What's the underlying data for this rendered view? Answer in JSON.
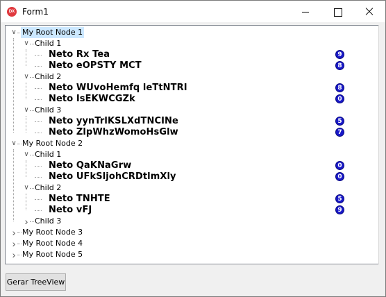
{
  "window": {
    "title": "Form1",
    "app_icon_text": "DX"
  },
  "tree": {
    "selected": "My Root Node 1",
    "rows": [
      {
        "type": "root",
        "label": "My Root Node 1",
        "expanded": true
      },
      {
        "type": "child",
        "label": "Child 1",
        "expanded": true
      },
      {
        "type": "leaf",
        "label": "Neto Rx Tea",
        "badge": "9"
      },
      {
        "type": "leaf",
        "label": "Neto eOPSTY MCT",
        "badge": "8"
      },
      {
        "type": "child",
        "label": "Child 2",
        "expanded": true
      },
      {
        "type": "leaf",
        "label": "Neto WUvoHemfq leTtNTRI",
        "badge": "8"
      },
      {
        "type": "leaf",
        "label": "Neto IsEKWCGZk",
        "badge": "0"
      },
      {
        "type": "child",
        "label": "Child 3",
        "expanded": true
      },
      {
        "type": "leaf",
        "label": "Neto yynTrlKSLXdTNCINe",
        "badge": "5"
      },
      {
        "type": "leaf",
        "label": "Neto ZlpWhzWomoHsGlw",
        "badge": "7"
      },
      {
        "type": "root",
        "label": "My Root Node 2",
        "expanded": true
      },
      {
        "type": "child",
        "label": "Child 1",
        "expanded": true
      },
      {
        "type": "leaf",
        "label": "Neto QaKNaGrw",
        "badge": "0"
      },
      {
        "type": "leaf",
        "label": "Neto UFkSljohCRDtlmXly",
        "badge": "0"
      },
      {
        "type": "child",
        "label": "Child 2",
        "expanded": true
      },
      {
        "type": "leaf",
        "label": "Neto TNHTE",
        "badge": "5"
      },
      {
        "type": "leaf",
        "label": "Neto vFJ",
        "badge": "9"
      },
      {
        "type": "child",
        "label": "Child 3",
        "expanded": false
      },
      {
        "type": "root",
        "label": "My Root Node 3",
        "expanded": false
      },
      {
        "type": "root",
        "label": "My Root Node 4",
        "expanded": false
      },
      {
        "type": "root",
        "label": "My Root Node 5",
        "expanded": false
      }
    ]
  },
  "footer": {
    "button_label": "Gerar TreeView"
  },
  "colors": {
    "badge": "#1818c8",
    "selection": "#cce8ff"
  }
}
